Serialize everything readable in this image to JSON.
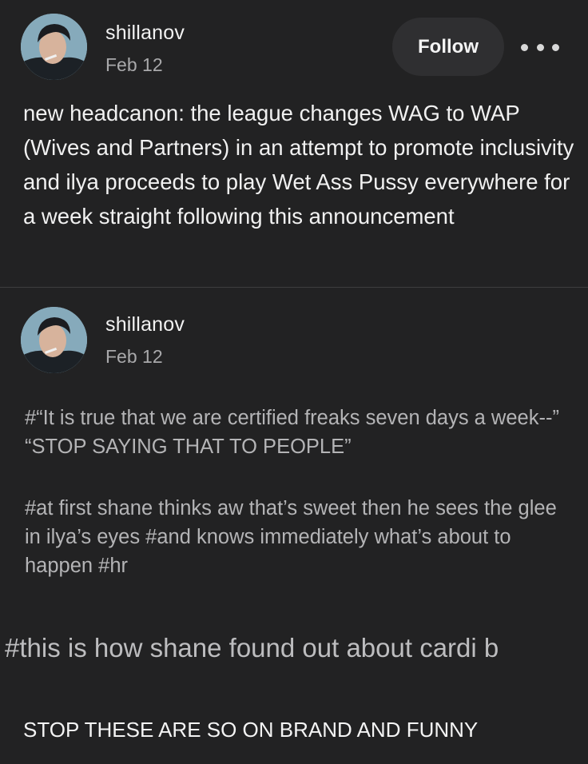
{
  "posts": [
    {
      "username": "shillanov",
      "date": "Feb 12",
      "follow_label": "Follow",
      "more_icon": "more-dots-icon",
      "body": "new headcanon: the league changes WAG to WAP (Wives and Partners) in an attempt to promote inclusivity and ilya proceeds to play Wet Ass Pussy everywhere for a week straight following this announcement"
    },
    {
      "username": "shillanov",
      "date": "Feb 12",
      "tags_line_1": "#“It is true that we are certified freaks seven days a week--” “STOP SAYING THAT TO PEOPLE”",
      "tags_line_2": "#at first shane thinks aw that’s sweet then he sees the glee in ilya’s eyes  #and knows immediately what’s about to happen  #hr"
    }
  ],
  "overlay": {
    "big_tag": "#this is how shane found out about cardi b",
    "caption": "STOP THESE ARE SO ON BRAND AND FUNNY"
  },
  "colors": {
    "background": "#222223",
    "text": "#f1f1f1",
    "muted": "#a9a9ab",
    "button_bg": "#2f2f31"
  }
}
